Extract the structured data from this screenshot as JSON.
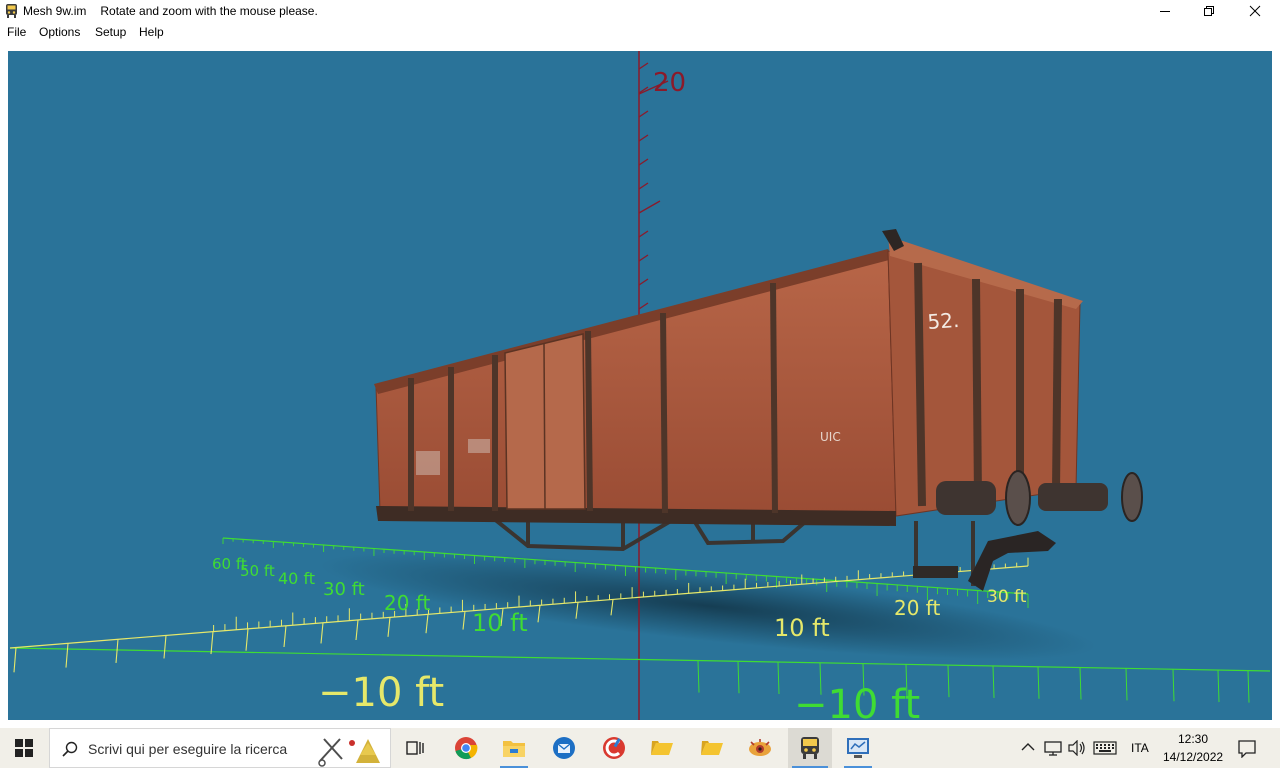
{
  "window": {
    "title": "Mesh 9w.im",
    "subtitle": "Rotate and zoom with the mouse please."
  },
  "menu": {
    "items": [
      {
        "label": "File"
      },
      {
        "label": "Options"
      },
      {
        "label": "Setup"
      },
      {
        "label": "Help"
      }
    ]
  },
  "scene": {
    "vertical_axis_label": "20",
    "depth_axis_labels": [
      "60 ft",
      "50 ft",
      "40 ft",
      "30 ft",
      "20 ft",
      "10 ft"
    ],
    "width_axis_labels": [
      "10 ft",
      "20 ft",
      "30 ft"
    ],
    "front_labels": [
      "−10 ft",
      "−10 ft"
    ],
    "wagon_markings": {
      "number": "52.",
      "badge": "UIC"
    },
    "colors": {
      "background": "#2a7399",
      "wagon": "#a9573b",
      "grid_green": "#3fdc33",
      "grid_yellow": "#e6e86a",
      "axis_red": "#8b1a2a"
    }
  },
  "taskbar": {
    "search_placeholder": "Scrivi qui per eseguire la ricerca",
    "language": "ITA",
    "time": "12:30",
    "date": "14/12/2022",
    "apps": [
      "start-icon",
      "task-view-icon",
      "chrome-icon",
      "file-explorer-icon",
      "thunderbird-icon",
      "ccleaner-icon",
      "folder-icon",
      "folder-icon",
      "app-icon",
      "train-app-icon",
      "control-panel-icon"
    ]
  }
}
